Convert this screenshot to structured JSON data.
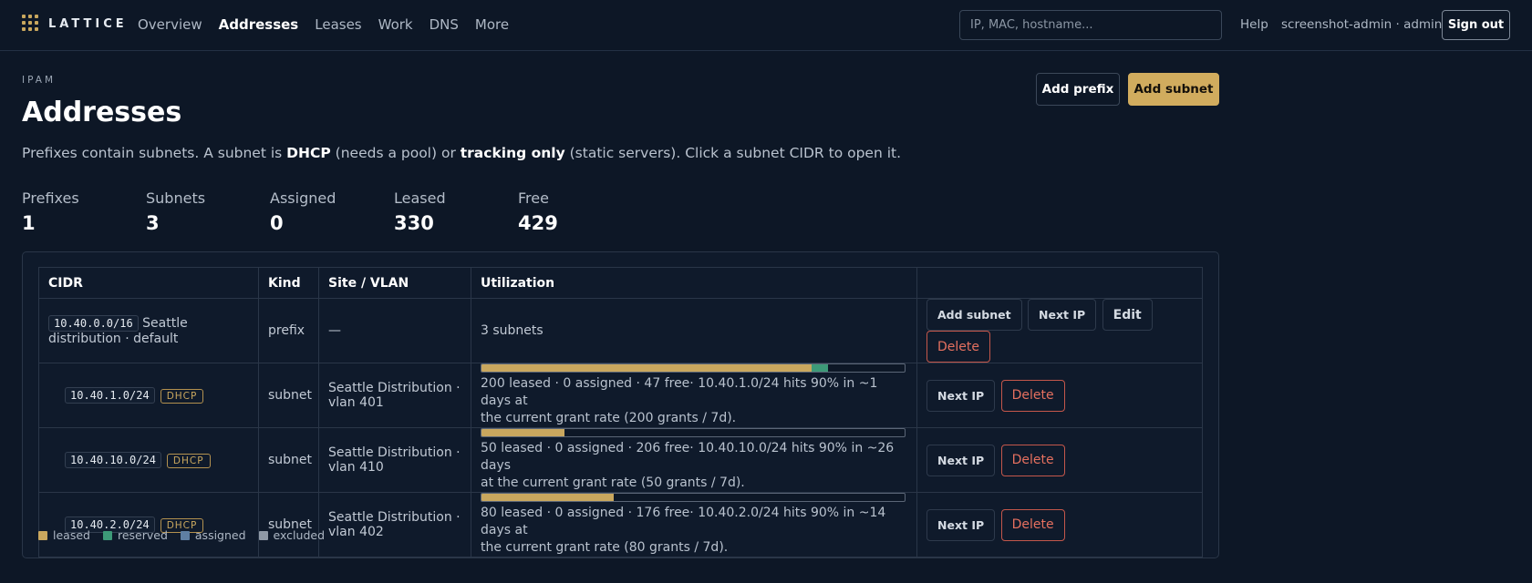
{
  "brand": {
    "name": "LATTICE"
  },
  "nav": [
    {
      "label": "Overview",
      "active": false
    },
    {
      "label": "Addresses",
      "active": true
    },
    {
      "label": "Leases",
      "active": false
    },
    {
      "label": "Work",
      "active": false
    },
    {
      "label": "DNS",
      "active": false
    },
    {
      "label": "More",
      "active": false
    }
  ],
  "search": {
    "placeholder": "IP, MAC, hostname..."
  },
  "header_right": {
    "help": "Help",
    "user": "screenshot-admin · admin",
    "signout": "Sign out"
  },
  "page": {
    "eyebrow": "IPAM",
    "title": "Addresses",
    "add_prefix": "Add prefix",
    "add_subnet": "Add subnet",
    "intro": {
      "p1": "Prefixes contain subnets. A subnet is ",
      "b1": "DHCP",
      "p2": " (needs a pool) or ",
      "b2": "tracking only",
      "p3": " (static servers). Click a subnet CIDR to open it."
    }
  },
  "stats": [
    {
      "label": "Prefixes",
      "value": "1"
    },
    {
      "label": "Subnets",
      "value": "3"
    },
    {
      "label": "Assigned",
      "value": "0"
    },
    {
      "label": "Leased",
      "value": "330"
    },
    {
      "label": "Free",
      "value": "429"
    }
  ],
  "table": {
    "columns": [
      "CIDR",
      "Kind",
      "Site / VLAN",
      "Utilization",
      ""
    ],
    "prefix_row": {
      "cidr": "10.40.0.0/16",
      "site_line1": "Seattle",
      "site_line2": "distribution · default",
      "kind": "prefix",
      "site_vlan": "—",
      "utilization": "3 subnets",
      "actions": {
        "add_subnet": "Add subnet",
        "next_ip": "Next IP",
        "edit": "Edit",
        "delete": "Delete"
      }
    },
    "subnet_rows": [
      {
        "cidr": "10.40.1.0/24",
        "badge": "DHCP",
        "kind": "subnet",
        "site_line1": "Seattle Distribution ·",
        "site_line2": "vlan 401",
        "leased_fraction": 0.78,
        "reserved_fraction": 0.04,
        "util_line1": "200 leased · 0 assigned · 47 free· 10.40.1.0/24 hits 90% in ~1 days at",
        "util_line2": "the current grant rate (200 grants / 7d).",
        "next_ip": "Next IP",
        "delete": "Delete"
      },
      {
        "cidr": "10.40.10.0/24",
        "badge": "DHCP",
        "kind": "subnet",
        "site_line1": "Seattle Distribution ·",
        "site_line2": "vlan 410",
        "leased_fraction": 0.196,
        "reserved_fraction": 0,
        "util_line1": "50 leased · 0 assigned · 206 free· 10.40.10.0/24 hits 90% in ~26 days",
        "util_line2": "at the current grant rate (50 grants / 7d).",
        "next_ip": "Next IP",
        "delete": "Delete"
      },
      {
        "cidr": "10.40.2.0/24",
        "badge": "DHCP",
        "kind": "subnet",
        "site_line1": "Seattle Distribution ·",
        "site_line2": "vlan 402",
        "leased_fraction": 0.313,
        "reserved_fraction": 0,
        "util_line1": "80 leased · 0 assigned · 176 free· 10.40.2.0/24 hits 90% in ~14 days at",
        "util_line2": "the current grant rate (80 grants / 7d).",
        "next_ip": "Next IP",
        "delete": "Delete"
      }
    ]
  },
  "legend": [
    {
      "label": "leased",
      "color": "#c9a75e"
    },
    {
      "label": "reserved",
      "color": "#3d9a78"
    },
    {
      "label": "assigned",
      "color": "#5f7fa3"
    },
    {
      "label": "excluded",
      "color": "#8f99a6"
    }
  ]
}
